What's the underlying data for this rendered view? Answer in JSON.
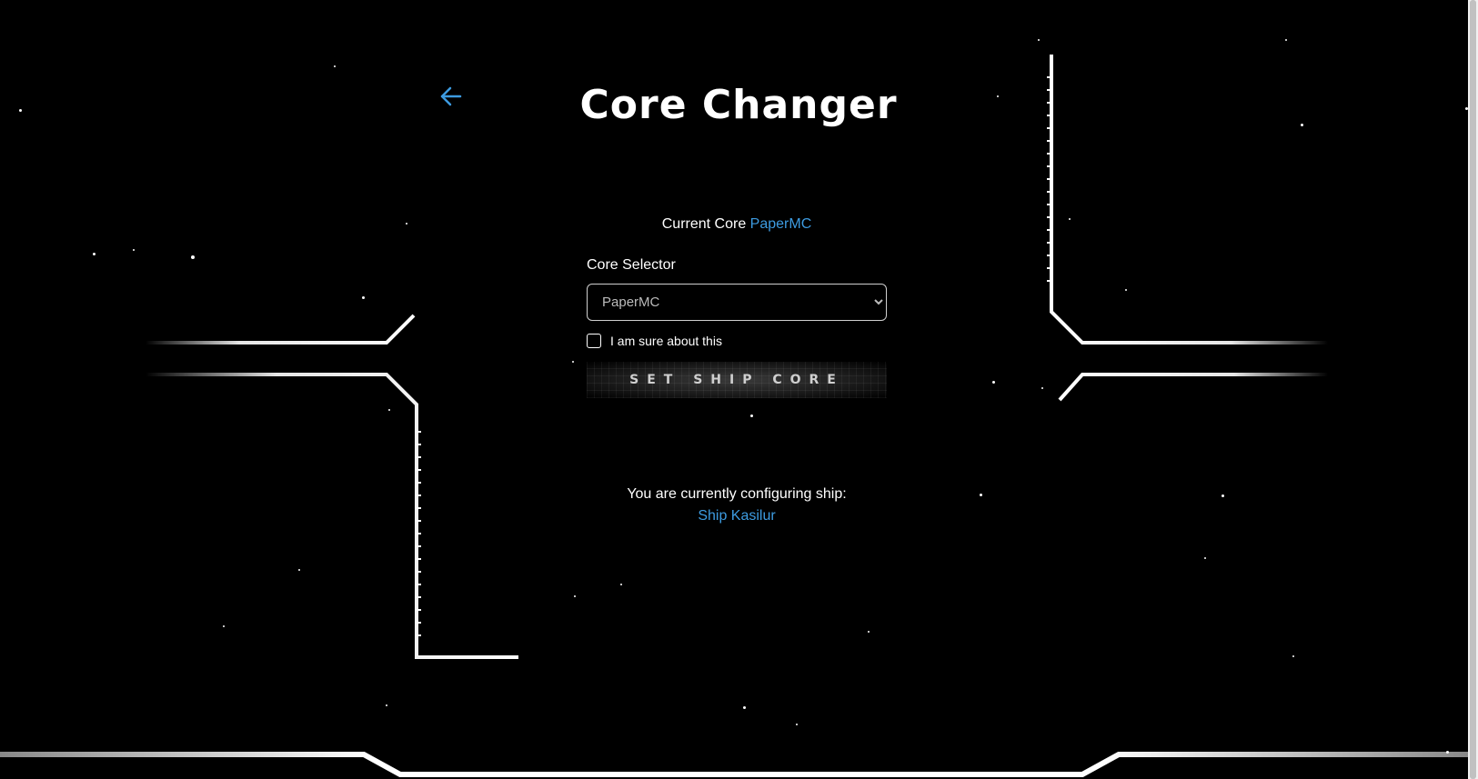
{
  "app": {
    "title": "Core Changer"
  },
  "nav": {
    "back_icon": "arrow-left-icon"
  },
  "current_core": {
    "label": "Current Core",
    "value": "PaperMC"
  },
  "core_selector": {
    "label": "Core Selector",
    "selected": "PaperMC"
  },
  "confirm": {
    "label": "I am sure about this",
    "checked": false
  },
  "set_core_button": {
    "label": "SET SHIP CORE"
  },
  "ship": {
    "label": "You are currently configuring ship:",
    "name": "Ship Kasilur"
  },
  "colors": {
    "background": "#000000",
    "accent": "#3d9be0",
    "frame": "#ffffff",
    "frame_accent": "#1e90e0"
  }
}
